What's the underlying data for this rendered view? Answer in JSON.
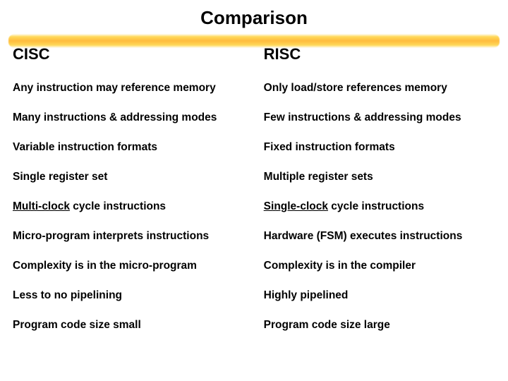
{
  "title": "Comparison",
  "headers": {
    "left": "CISC",
    "right": "RISC"
  },
  "rows": [
    {
      "left": {
        "plain": "Any instruction may reference memory"
      },
      "right": {
        "plain": "Only load/store references memory"
      }
    },
    {
      "left": {
        "plain": "Many instructions & addressing modes"
      },
      "right": {
        "plain": "Few instructions & addressing modes"
      }
    },
    {
      "left": {
        "plain": "Variable instruction formats"
      },
      "right": {
        "plain": "Fixed instruction formats"
      }
    },
    {
      "left": {
        "plain": "Single register set"
      },
      "right": {
        "plain": "Multiple register sets"
      }
    },
    {
      "left": {
        "uline": "Multi-clock",
        "rest": " cycle instructions"
      },
      "right": {
        "uline": "Single-clock",
        "rest": " cycle instructions"
      }
    },
    {
      "left": {
        "plain": "Micro-program interprets instructions"
      },
      "right": {
        "plain": "Hardware (FSM) executes instructions"
      }
    },
    {
      "left": {
        "plain": "Complexity is in the micro-program"
      },
      "right": {
        "plain": "Complexity is in the compiler"
      }
    },
    {
      "left": {
        "plain": "Less to no pipelining"
      },
      "right": {
        "plain": "Highly pipelined"
      }
    },
    {
      "left": {
        "plain": "Program code size small"
      },
      "right": {
        "plain": "Program code size large"
      }
    }
  ]
}
